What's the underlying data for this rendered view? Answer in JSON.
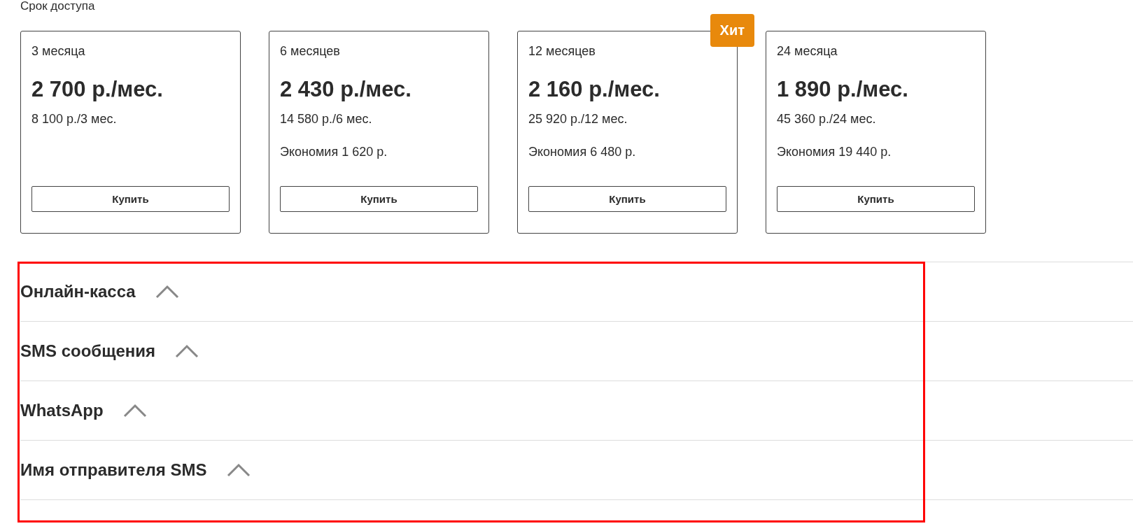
{
  "section_title": "Срок доступа",
  "plans": [
    {
      "period": "3 месяца",
      "price": "2 700 р./мес.",
      "total": "8 100 р./3 мес.",
      "buy_label": "Купить"
    },
    {
      "period": "6 месяцев",
      "price": "2 430 р./мес.",
      "total": "14 580 р./6 мес.",
      "savings": "Экономия 1 620 р.",
      "buy_label": "Купить"
    },
    {
      "period": "12 месяцев",
      "price": "2 160 р./мес.",
      "total": "25 920 р./12 мес.",
      "savings": "Экономия 6 480 р.",
      "buy_label": "Купить",
      "badge": "Хит"
    },
    {
      "period": "24 месяца",
      "price": "1 890 р./мес.",
      "total": "45 360 р./24 мес.",
      "savings": "Экономия 19 440 р.",
      "buy_label": "Купить"
    }
  ],
  "addons": [
    {
      "title": "Онлайн-касса"
    },
    {
      "title": "SMS сообщения"
    },
    {
      "title": "WhatsApp"
    },
    {
      "title": "Имя отправителя SMS"
    }
  ]
}
